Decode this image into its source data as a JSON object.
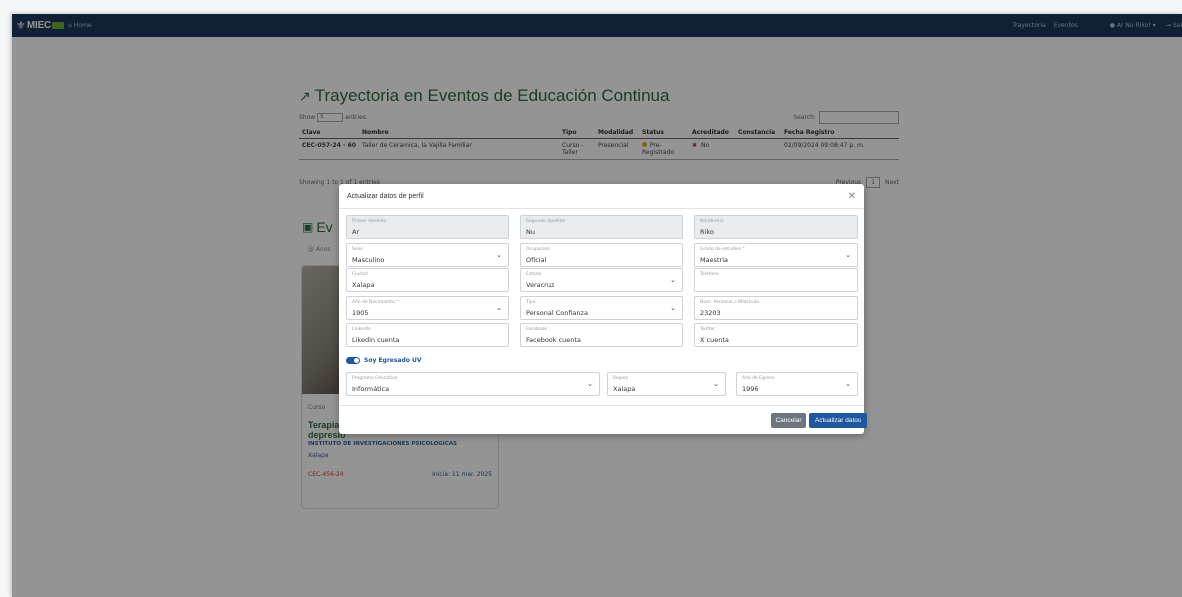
{
  "navbar": {
    "brand": "MIEC",
    "home": "Home",
    "links": [
      "Trayectoria",
      "Eventos"
    ],
    "user": "Ar Nu Riko!",
    "logout": "Sal"
  },
  "page": {
    "title": "Trayectoria en Eventos de Educación Continua",
    "show_label": "Show",
    "show_value": "5",
    "entries_label": "entries",
    "search_label": "Search:",
    "columns": [
      "Clave",
      "Nombre",
      "Tipo",
      "Modalidad",
      "Status",
      "Acreditado",
      "Constancia",
      "Fecha Registro"
    ],
    "row": {
      "clave": "CEC-057-24 - 60",
      "nombre": "Taller de Ceramica, la Vajilla Familiar",
      "tipo": "Curso - Taller",
      "modalidad": "Presencial",
      "status": "Pre-Registrado",
      "acreditado": "No",
      "constancia": "",
      "fecha": "02/09/2024 09:08:47 p. m."
    },
    "showing": "Showing 1 to 1 of 1 entries",
    "previous": "Previous",
    "page_number": "1",
    "next": "Next",
    "section_title": "Ev",
    "section_sub": "Anos",
    "card": {
      "type": "Curso",
      "title_1": "Terapia",
      "title_2": "depresió",
      "institute": "INSTITUTO DE INVESTIGACIONES PSICOLOGICAS",
      "city": "Xalapa",
      "code": "CEC-456-24",
      "date": "Inicia: 11 mar. 2025"
    }
  },
  "modal": {
    "title": "Actualizar datos de perfil",
    "fields": {
      "primer_apellido": {
        "label": "Primer Apellido",
        "value": "Ar"
      },
      "segundo_apellido": {
        "label": "Segundo Apellido",
        "value": "Nu"
      },
      "nombre": {
        "label": "Nombre(s)",
        "value": "Riko"
      },
      "sexo": {
        "label": "Sexo",
        "value": "Masculino"
      },
      "ocupacion": {
        "label": "Ocupacion",
        "value": "Oficial"
      },
      "grado": {
        "label": "Grado de estudios *",
        "value": "Maestria"
      },
      "ciudad": {
        "label": "Ciudad",
        "value": "Xalapa"
      },
      "estado": {
        "label": "Estado",
        "value": "Veracruz"
      },
      "telefono": {
        "label": "Telefono",
        "value": ""
      },
      "anio_nacimiento": {
        "label": "Año de Nacimiento *",
        "value": "1905"
      },
      "tipo": {
        "label": "Tipo",
        "value": "Personal Confianza"
      },
      "num_personal": {
        "label": "Num. Personal o Matrícula",
        "value": "23203"
      },
      "linkedin": {
        "label": "LinkedIn",
        "value": "Likedin cuenta"
      },
      "facebook": {
        "label": "Facebook",
        "value": "Facebook cuenta"
      },
      "twitter": {
        "label": "Twitter",
        "value": "X cuenta"
      },
      "programa": {
        "label": "Programa Educativo",
        "value": "Informática"
      },
      "region": {
        "label": "Region",
        "value": "Xalapa"
      },
      "anio_egreso": {
        "label": "Año de Egreso",
        "value": "1996"
      }
    },
    "switch_label": "Soy Egresado UV",
    "cancel": "Cancelar",
    "save": "Actualizar datos"
  },
  "colors": {
    "navbar": "#1c3760",
    "accent_green": "#2d6b45",
    "primary_blue": "#1e56a0",
    "cancel_gray": "#6c757d"
  }
}
